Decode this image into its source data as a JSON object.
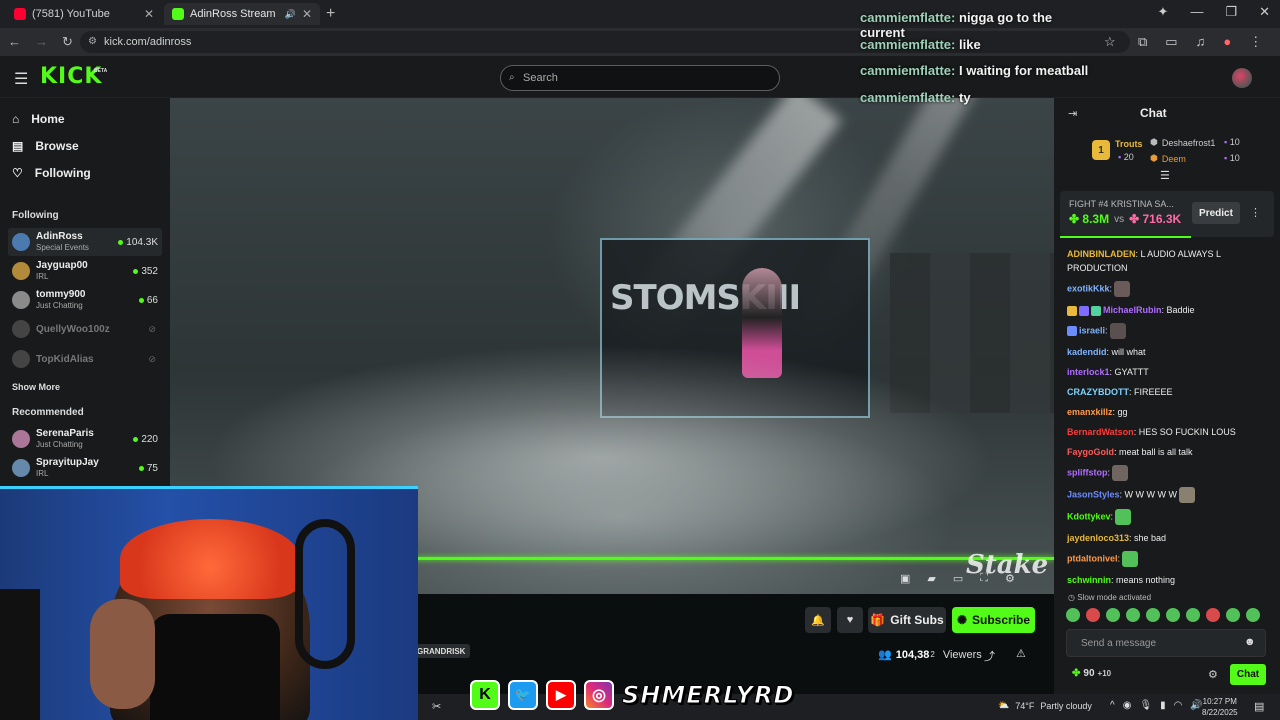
{
  "browser": {
    "tabs": [
      {
        "label": "(7581) YouTube",
        "close": "✕",
        "color": "#ff0033"
      },
      {
        "label": "AdinRoss Stream - Watch L",
        "close": "✕",
        "color": "#53fc18"
      }
    ],
    "new_tab": "+",
    "url": "kick.com/adinross",
    "window_controls": [
      "✦",
      "—",
      "❐",
      "✕"
    ]
  },
  "kick": {
    "logo": "KICK",
    "beta": "BETA",
    "search_placeholder": "Search",
    "nav": [
      {
        "label": "Home",
        "icon": "home-icon"
      },
      {
        "label": "Browse",
        "icon": "browse-icon"
      },
      {
        "label": "Following",
        "icon": "heart-icon"
      }
    ],
    "following_header": "Following",
    "following": [
      {
        "name": "AdinRoss",
        "category": "Special Events",
        "viewers": "104.3K",
        "active": true,
        "color": "#4a7ab0"
      },
      {
        "name": "Jayguap00",
        "category": "IRL",
        "viewers": "352",
        "color": "#b38a3a"
      },
      {
        "name": "tommy900",
        "category": "Just Chatting",
        "viewers": "66",
        "color": "#8a8a8a"
      },
      {
        "name": "QuellyWoo100z",
        "offline": true,
        "color": "#555"
      },
      {
        "name": "TopKidAlias",
        "offline": true,
        "color": "#555"
      }
    ],
    "show_more": "Show More",
    "recommended_header": "Recommended",
    "recommended": [
      {
        "name": "SerenaParis",
        "category": "Just Chatting",
        "viewers": "220",
        "color": "#aa7799"
      },
      {
        "name": "SprayitupJay",
        "category": "IRL",
        "viewers": "75",
        "color": "#6688aa"
      }
    ]
  },
  "video": {
    "screen_text": "STOMSKIII",
    "watermark": "Stake",
    "tag": "GRANDRISK",
    "viewers": "104,38",
    "viewers_sub": "2",
    "viewers_label": "Viewers",
    "progress": 1.0
  },
  "actions": {
    "gift_subs": "Gift Subs",
    "subscribe": "Subscribe"
  },
  "overlay_chat": [
    {
      "user": "cammiemflatte:",
      "text": "nigga go to the current"
    },
    {
      "user": "cammiemflatte:",
      "text": "like"
    },
    {
      "user": "cammiemflatte:",
      "text": "I waiting for meatball"
    },
    {
      "user": "cammiemflatte:",
      "text": "ty"
    }
  ],
  "chat": {
    "title": "Chat",
    "leaderboard": {
      "first": {
        "rank": "1",
        "name": "Trouts",
        "count": "20"
      },
      "second": {
        "name": "Deshaefrost1",
        "count": "10"
      },
      "third": {
        "name": "Deem",
        "count": "10"
      }
    },
    "prediction": {
      "title": "FIGHT #4 KRISTINA SA...",
      "a": "8.3M",
      "vs": "vs",
      "b": "716.3K",
      "button": "Predict",
      "a_share": 0.61
    },
    "messages": [
      {
        "user": "ADINBINLADEN",
        "text": ": L AUDIO ALWAYS L PRODUCTION",
        "color": "#e8b93a"
      },
      {
        "user": "exotikKkk",
        "text": ":",
        "color": "#7fb3ff",
        "emote": "#6a5a5a"
      },
      {
        "user": "MichaelRubin",
        "text": ": Baddie",
        "color": "#b06cff",
        "badges": [
          "#e8b93a",
          "#7f6cff",
          "#53d1a0"
        ]
      },
      {
        "user": "israeli",
        "text": ":",
        "color": "#7fb3ff",
        "emote": "#5a5050",
        "badges": [
          "#6b8cff"
        ]
      },
      {
        "user": "kadendid",
        "text": ": will what",
        "color": "#7fb3ff"
      },
      {
        "user": "interlock1",
        "text": ": GYATTT",
        "color": "#b06cff"
      },
      {
        "user": "CRAZYBDOTT",
        "text": ": FIREEEE",
        "color": "#7fd3ff"
      },
      {
        "user": "emanxkillz",
        "text": ": gg",
        "color": "#ff9a4a"
      },
      {
        "user": "BernardWatson",
        "text": ": HES SO FUCKIN LOUS",
        "color": "#ff3b3b"
      },
      {
        "user": "FaygoGold",
        "text": ": meat ball is all talk",
        "color": "#ff5a5a"
      },
      {
        "user": "spliffstop",
        "text": ":",
        "color": "#b06cff",
        "emote": "#706560"
      },
      {
        "user": "JasonStyles",
        "text": ": W W W W W",
        "color": "#6b8cff",
        "emote": "#8a8070"
      },
      {
        "user": "Kdottykev",
        "text": ":",
        "color": "#53fc18",
        "emote": "#53c15a"
      },
      {
        "user": "jaydenloco313",
        "text": ": she bad",
        "color": "#e8b93a"
      },
      {
        "user": "ptdaltonivel",
        "text": ":",
        "color": "#ff9a4a",
        "emote": "#53c15a"
      },
      {
        "user": "schwinnin",
        "text": ": means nothing",
        "color": "#53fc18"
      }
    ],
    "slow_mode": "Slow mode activated",
    "input_placeholder": "Send a message",
    "points": "90",
    "points_bonus": "+10",
    "send_button": "Chat"
  },
  "stream_overlay": {
    "name": "SHMERLYRD",
    "icons": [
      "K",
      "🐦",
      "▶",
      "◎"
    ]
  },
  "taskbar": {
    "temp": "74°F",
    "weather": "Partly cloudy",
    "time": "10:27 PM",
    "date": "8/22/2025"
  }
}
